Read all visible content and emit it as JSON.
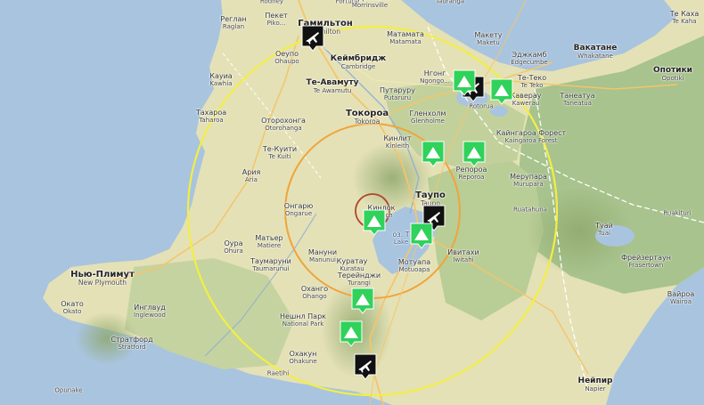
{
  "map": {
    "places": [
      {
        "id": "rodney",
        "ru": "",
        "en": "Rodney"
      },
      {
        "id": "fortune",
        "ru": "",
        "en": "Fortune"
      },
      {
        "id": "morrinsville",
        "ru": "Моррінсвілл",
        "en": "Morrinsville"
      },
      {
        "id": "tauranga",
        "ru": "",
        "en": "Tauranga"
      },
      {
        "id": "te-kaha",
        "ru": "Те Каха",
        "en": "Te Kaha"
      },
      {
        "id": "raglan",
        "ru": "Реглан",
        "en": "Raglan"
      },
      {
        "id": "pekat",
        "ru": "Пекет",
        "en": "Piko..."
      },
      {
        "id": "hamilton",
        "ru": "Гамильтон",
        "en": "Hamilton"
      },
      {
        "id": "matamata",
        "ru": "Матамата",
        "en": "Matamata"
      },
      {
        "id": "maketu",
        "ru": "Макету",
        "en": "Maketu"
      },
      {
        "id": "edgecumbe",
        "ru": "Эджкамб",
        "en": "Edgecumbe"
      },
      {
        "id": "whakatane",
        "ru": "Вакатане",
        "en": "Whakatane"
      },
      {
        "id": "ohaupo",
        "ru": "Оеупо",
        "en": "Ohaupo"
      },
      {
        "id": "cambridge",
        "ru": "Кеймбридж",
        "en": "Cambridge"
      },
      {
        "id": "kawhia",
        "ru": "Кауиа",
        "en": "Kawhia"
      },
      {
        "id": "te-awamutu",
        "ru": "Те-Авамуту",
        "en": "Te Awamutu"
      },
      {
        "id": "putaruru",
        "ru": "Путаруру",
        "en": "Putaruru"
      },
      {
        "id": "ngongotaha",
        "ru": "Нгонг",
        "en": "Ngongo..."
      },
      {
        "id": "te-teko",
        "ru": "Те-Теко",
        "en": "Te Teko"
      },
      {
        "id": "opotiki",
        "ru": "Опотики",
        "en": "Opotiki"
      },
      {
        "id": "rotorua",
        "ru": "",
        "en": "Rotorua"
      },
      {
        "id": "kawerau",
        "ru": "Каверау",
        "en": "Kawerau"
      },
      {
        "id": "taneatua",
        "ru": "Танеатуа",
        "en": "Taneatua"
      },
      {
        "id": "taharoa",
        "ru": "Тахароа",
        "en": "Taharoa"
      },
      {
        "id": "otorohanga",
        "ru": "Оторохонга",
        "en": "Otorohanga"
      },
      {
        "id": "tokoroa",
        "ru": "Токороа",
        "en": "Tokoroa"
      },
      {
        "id": "glenholme",
        "ru": "Гленхолм",
        "en": "Glenholme"
      },
      {
        "id": "kaingaroa",
        "ru": "Кайнгароа Форест",
        "en": "Kaingaroa Forest"
      },
      {
        "id": "kinleith",
        "ru": "Кинлит",
        "en": "Kinleith"
      },
      {
        "id": "te-kuiti",
        "ru": "Те-Куити",
        "en": "Te Kuiti"
      },
      {
        "id": "reporoa",
        "ru": "Репороа",
        "en": "Reporoa"
      },
      {
        "id": "aria",
        "ru": "Ария",
        "en": "Aria"
      },
      {
        "id": "murupara",
        "ru": "Мерупара",
        "en": "Murupara"
      },
      {
        "id": "taupo",
        "ru": "Таупо",
        "en": "Taupo"
      },
      {
        "id": "ongarue",
        "ru": "Онгарю",
        "en": "Ongarue"
      },
      {
        "id": "kinloch",
        "ru": "Кинлок",
        "en": "Kinloch"
      },
      {
        "id": "ruatahuna",
        "ru": "",
        "en": "Ruatahuna"
      },
      {
        "id": "ruakituri",
        "ru": "",
        "en": "Ruakituri"
      },
      {
        "id": "tuai",
        "ru": "Туай",
        "en": "Tuai"
      },
      {
        "id": "lake-taupo",
        "ru": "оз. Т",
        "en": "Lake"
      },
      {
        "id": "ohura",
        "ru": "Оура",
        "en": "Ohura"
      },
      {
        "id": "manunui",
        "ru": "Мануни",
        "en": "Manunui"
      },
      {
        "id": "matiere",
        "ru": "Матьер",
        "en": "Matiere"
      },
      {
        "id": "kuratau",
        "ru": "Куратау",
        "en": "Kuratau"
      },
      {
        "id": "taumarunui",
        "ru": "Таумаруни",
        "en": "Taumarunui"
      },
      {
        "id": "iwitahi",
        "ru": "Ивитахи",
        "en": "Iwitahi"
      },
      {
        "id": "frasertown",
        "ru": "Фрейзертаун",
        "en": "Frasertown"
      },
      {
        "id": "new-plymouth",
        "ru": "Нью-Плимут",
        "en": "New Plymouth"
      },
      {
        "id": "motuoapa",
        "ru": "Мотуапа",
        "en": "Motuoapa"
      },
      {
        "id": "turangi",
        "ru": "Терейнджи",
        "en": "Turangi"
      },
      {
        "id": "ohango",
        "ru": "Охангo",
        "en": "Ohango"
      },
      {
        "id": "okato",
        "ru": "Окато",
        "en": "Okato"
      },
      {
        "id": "inglewood",
        "ru": "Инглвуд",
        "en": "Inglewood"
      },
      {
        "id": "national-park",
        "ru": "Нешнл Парк",
        "en": "National Park"
      },
      {
        "id": "wairoa",
        "ru": "Вайроа",
        "en": "Wairoa"
      },
      {
        "id": "stratford",
        "ru": "Стратфорд",
        "en": "Stratford"
      },
      {
        "id": "ohakune",
        "ru": "Охакун",
        "en": "Ohakune"
      },
      {
        "id": "raetihi",
        "ru": "",
        "en": "Raetihi"
      },
      {
        "id": "opunake",
        "ru": "",
        "en": "Opunake"
      },
      {
        "id": "napier",
        "ru": "Нейпир",
        "en": "Napier"
      }
    ],
    "markers": [
      {
        "id": "airport-hamilton",
        "type": "airport",
        "icon": "airplane-icon"
      },
      {
        "id": "airport-rotorua",
        "type": "airport",
        "icon": "airplane-icon"
      },
      {
        "id": "airport-taupo",
        "type": "airport",
        "icon": "airplane-icon"
      },
      {
        "id": "airport-waiouru",
        "type": "airport",
        "icon": "airplane-icon"
      },
      {
        "id": "volcano-1",
        "type": "volcano",
        "icon": "volcano-icon"
      },
      {
        "id": "volcano-2",
        "type": "volcano",
        "icon": "volcano-icon"
      },
      {
        "id": "volcano-3",
        "type": "volcano",
        "icon": "volcano-icon"
      },
      {
        "id": "volcano-4",
        "type": "volcano",
        "icon": "volcano-icon"
      },
      {
        "id": "volcano-5",
        "type": "volcano",
        "icon": "volcano-icon"
      },
      {
        "id": "volcano-6",
        "type": "volcano",
        "icon": "volcano-icon"
      },
      {
        "id": "volcano-7",
        "type": "volcano",
        "icon": "volcano-icon"
      },
      {
        "id": "volcano-8",
        "type": "volcano",
        "icon": "volcano-icon"
      }
    ],
    "colors": {
      "sea": "#a9c4de",
      "land": "#e4e1b6",
      "forest": "#a8c38d",
      "outer_ring": "#f2ee45",
      "middle_ring": "#f0a43a",
      "inner_ring": "#b0452a",
      "airport_marker": "#111111",
      "volcano_marker": "#2fd25a"
    }
  }
}
